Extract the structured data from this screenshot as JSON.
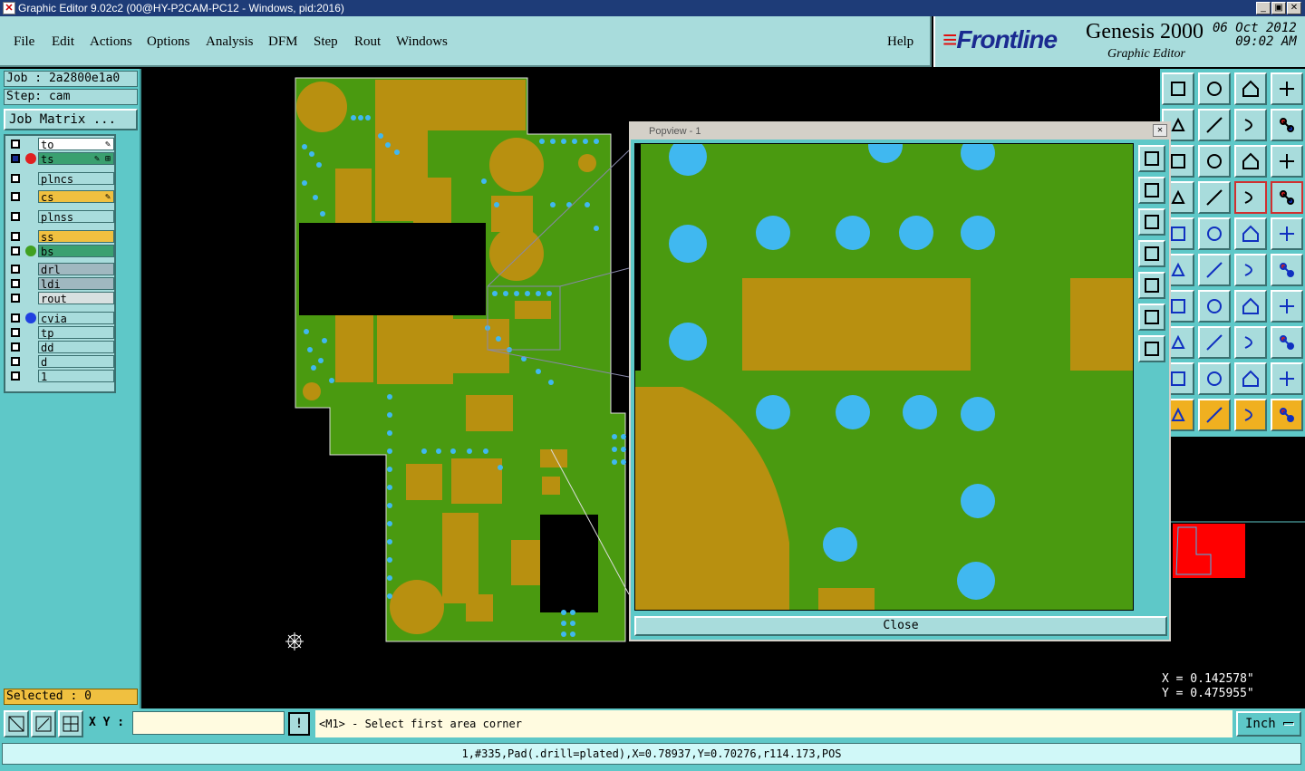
{
  "window": {
    "title": "Graphic Editor 9.02c2 (00@HY-P2CAM-PC12 - Windows, pid:2016)"
  },
  "menu": [
    {
      "label": "File"
    },
    {
      "label": "Edit"
    },
    {
      "label": "Actions"
    },
    {
      "label": "Options"
    },
    {
      "label": "Analysis"
    },
    {
      "label": "DFM"
    },
    {
      "label": "Step"
    },
    {
      "label": "Rout"
    },
    {
      "label": "Windows"
    },
    {
      "label": "Help"
    }
  ],
  "logo": {
    "brand": "Frontline",
    "product": "Genesis 2000",
    "subtitle": "Graphic Editor",
    "date": "06 Oct 2012",
    "time": "09:02 AM"
  },
  "job": {
    "job_label": "Job : 2a2800e1a0",
    "step_label": "Step: cam",
    "matrix_button": "Job Matrix ..."
  },
  "layers": [
    {
      "name": "to",
      "color": "#ffffff",
      "dot": "",
      "mark": "✎"
    },
    {
      "name": "ts",
      "color": "#3aa070",
      "dot": "#e02020",
      "mark": "✎ ⊞",
      "active": true
    },
    {
      "name": "plncs",
      "color": "#a8dcdc",
      "dot": "",
      "mark": ""
    },
    {
      "name": "cs",
      "color": "#f0c040",
      "dot": "",
      "mark": "✎"
    },
    {
      "name": "plnss",
      "color": "#a8dcdc",
      "dot": "",
      "mark": ""
    },
    {
      "name": "ss",
      "color": "#f0c040",
      "dot": "",
      "mark": ""
    },
    {
      "name": "bs",
      "color": "#3aa070",
      "dot": "#40a020",
      "mark": ""
    },
    {
      "name": "drl",
      "color": "#a0b8c0",
      "dot": "",
      "mark": ""
    },
    {
      "name": "ldi",
      "color": "#a0b8c0",
      "dot": "",
      "mark": ""
    },
    {
      "name": "rout",
      "color": "#d8e0e0",
      "dot": "",
      "mark": ""
    },
    {
      "name": "cvia",
      "color": "#a8dcdc",
      "dot": "#2040e0",
      "mark": ""
    },
    {
      "name": "tp",
      "color": "#a8dcdc",
      "dot": "",
      "mark": ""
    },
    {
      "name": "dd",
      "color": "#a8dcdc",
      "dot": "",
      "mark": ""
    },
    {
      "name": "d",
      "color": "#a8dcdc",
      "dot": "",
      "mark": ""
    },
    {
      "name": "1",
      "color": "#a8dcdc",
      "dot": "",
      "mark": ""
    }
  ],
  "selected_label": "Selected : 0",
  "popview": {
    "title": "Popview - 1",
    "close_label": "Close"
  },
  "coords": {
    "x": "X = 0.142578\"",
    "y": "Y = 0.475955\""
  },
  "bottom": {
    "xy_label": "X Y :",
    "xy_value": "",
    "prompt": "<M1> - Select first area corner",
    "units": "Inch"
  },
  "status": "1,#335,Pad(.drill=plated),X=0.78937,Y=0.70276,r114.173,POS",
  "colors": {
    "board_green": "#4a9a10",
    "copper": "#b89010",
    "via_blue": "#40b8f0",
    "panel": "#5ec8c8",
    "panel_light": "#a8dcdc"
  }
}
